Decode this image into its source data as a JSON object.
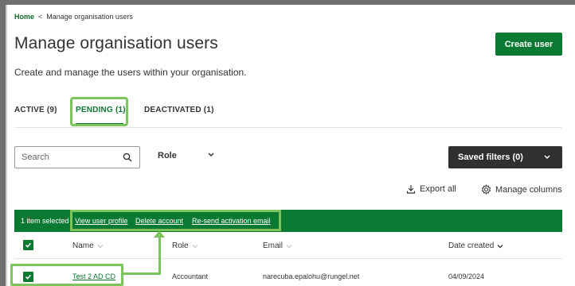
{
  "breadcrumb": {
    "home": "Home",
    "separator": "<",
    "current": "Manage organisation users"
  },
  "header": {
    "title": "Manage organisation users",
    "create_button": "Create user",
    "subtitle": "Create and manage the users within your organisation."
  },
  "tabs": [
    {
      "label": "ACTIVE (9)",
      "selected": false
    },
    {
      "label": "PENDING (1)",
      "selected": true
    },
    {
      "label": "DEACTIVATED (1)",
      "selected": false
    }
  ],
  "filters": {
    "search_placeholder": "Search",
    "role_label": "Role",
    "saved_filters_label": "Saved filters (0)"
  },
  "toolbar": {
    "export_label": "Export all",
    "manage_columns_label": "Manage columns"
  },
  "action_bar": {
    "selected_text": "1 item selected",
    "actions": [
      "View user profile",
      "Delete account",
      "Re-send activation email"
    ]
  },
  "table": {
    "columns": [
      "Name",
      "Role",
      "Email",
      "Date created"
    ],
    "rows": [
      {
        "name": "Test 2 AD CD",
        "role": "Accountant",
        "email": "narecuba.epalohu@rungel.net",
        "date_created": "04/09/2024",
        "checked": true
      }
    ]
  },
  "colors": {
    "brand_green": "#0a7a33",
    "highlight_green": "#7ec45c",
    "dark_button": "#2e3032"
  },
  "icons": [
    "search-icon",
    "chevron-down-icon",
    "download-icon",
    "gear-icon",
    "checkmark-icon",
    "sort-icon"
  ]
}
